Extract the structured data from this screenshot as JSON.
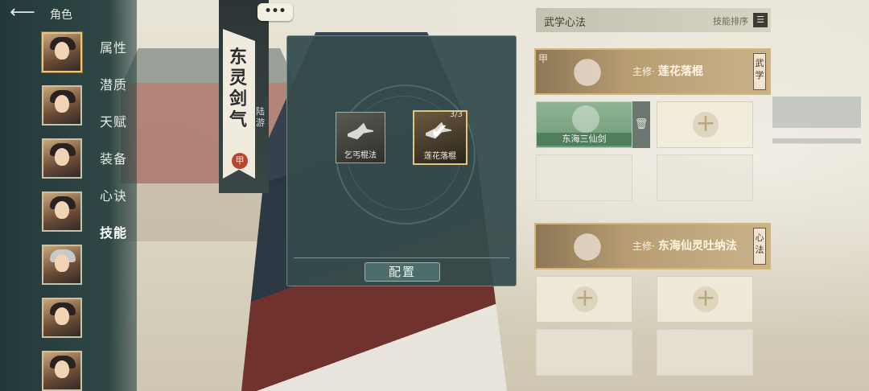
{
  "nav": {
    "title": "角色",
    "menu": [
      "属性",
      "潜质",
      "天赋",
      "装备",
      "心诀",
      "技能"
    ],
    "active_index": 5
  },
  "banner": {
    "name": "东灵剑气",
    "sect": "陆游",
    "seal": "甲"
  },
  "chat_button": "•••",
  "modal": {
    "skills": [
      {
        "label": "乞丐棍法",
        "selected": false
      },
      {
        "label": "莲花落棍",
        "selected": true,
        "count": "3/3"
      }
    ],
    "config_button": "配置"
  },
  "right_panel": {
    "title": "武学心法",
    "sort_label": "技能排序",
    "wuxue": {
      "tag": "甲",
      "prefix": "主修·",
      "name": "莲花落棍",
      "side_tag": "武学"
    },
    "filled_slot_label": "东海三仙剑",
    "xinfa": {
      "prefix": "主修·",
      "name": "东海仙灵吐纳法",
      "side_tag": "心法"
    }
  }
}
